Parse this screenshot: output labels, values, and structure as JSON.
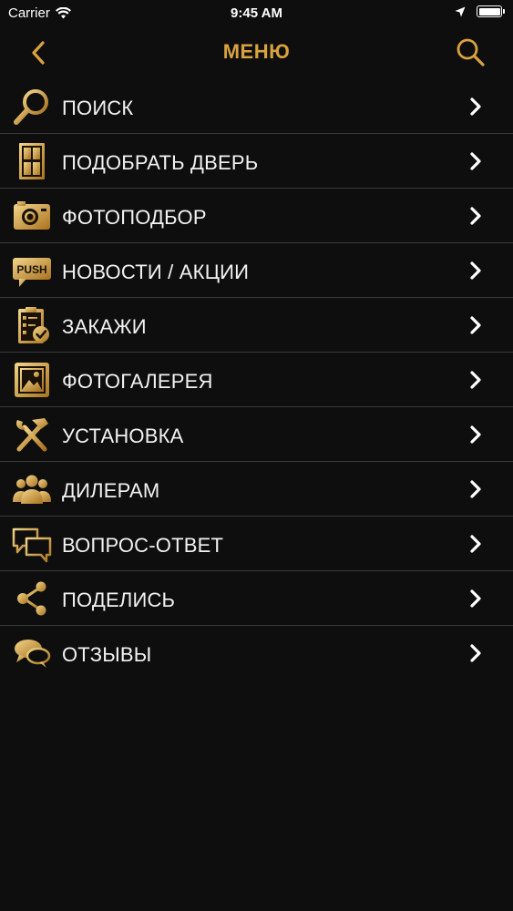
{
  "status_bar": {
    "carrier": "Carrier",
    "time": "9:45 AM"
  },
  "nav": {
    "title": "МЕНЮ"
  },
  "colors": {
    "accent_gold": "#d9a23f",
    "background": "#0e0e0e",
    "divider": "#3a3a3a"
  },
  "menu": {
    "items": [
      {
        "label": "ПОИСК",
        "icon": "magnifier-icon"
      },
      {
        "label": "ПОДОБРАТЬ ДВЕРЬ",
        "icon": "door-icon"
      },
      {
        "label": "ФОТОПОДБОР",
        "icon": "camera-icon"
      },
      {
        "label": "НОВОСТИ / АКЦИИ",
        "icon": "push-icon",
        "icon_text": "PUSH"
      },
      {
        "label": "ЗАКАЖИ",
        "icon": "clipboard-check-icon"
      },
      {
        "label": "ФОТОГАЛЕРЕЯ",
        "icon": "picture-frame-icon"
      },
      {
        "label": "УСТАНОВКА",
        "icon": "hammer-wrench-icon"
      },
      {
        "label": "ДИЛЕРАМ",
        "icon": "people-group-icon"
      },
      {
        "label": "ВОПРОС-ОТВЕТ",
        "icon": "chat-bubbles-icon"
      },
      {
        "label": "ПОДЕЛИСЬ",
        "icon": "share-icon"
      },
      {
        "label": "ОТЗЫВЫ",
        "icon": "speech-bubbles-icon"
      }
    ]
  }
}
